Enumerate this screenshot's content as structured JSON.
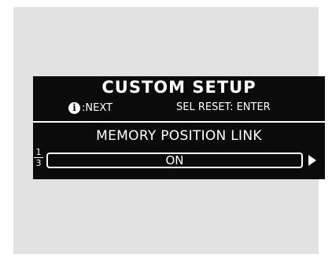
{
  "screen": {
    "title": "CUSTOM SETUP",
    "hint_next": ":NEXT",
    "hint_reset": "SEL RESET: ENTER",
    "item_label": "MEMORY POSITION LINK",
    "value": "ON",
    "page_current": "1",
    "page_total": "3",
    "icons": [
      "info-icon",
      "right-arrow-icon"
    ]
  }
}
